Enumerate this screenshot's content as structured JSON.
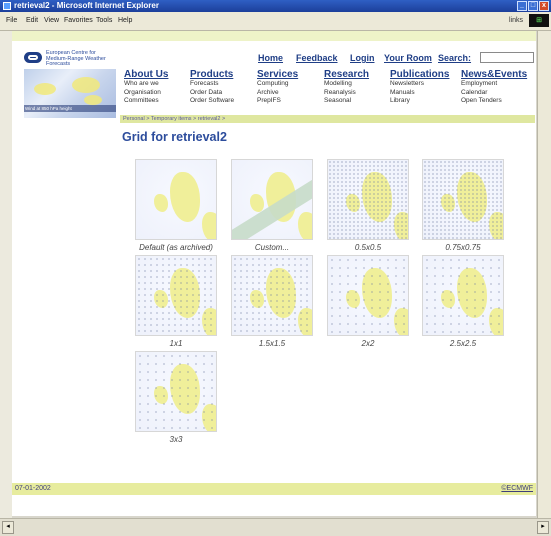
{
  "window": {
    "title": "retrieval2 - Microsoft Internet Explorer",
    "controls": [
      "_",
      "□",
      "x"
    ]
  },
  "menu": {
    "items": [
      "File",
      "Edit",
      "View",
      "Favorites",
      "Tools",
      "Help"
    ],
    "links_label": "links",
    "logo_glyph": "⊞"
  },
  "header": {
    "org_name": "European Centre for Medium-Range Weather Forecasts",
    "nav": [
      "Home",
      "Feedback",
      "Login",
      "Your Room",
      "Search:"
    ],
    "search_value": "",
    "weather_caption": "Wind at 850 hPa height"
  },
  "mainnav": [
    {
      "label": "About Us",
      "subs": [
        "Who are we",
        "Organisation",
        "Committees"
      ]
    },
    {
      "label": "Products",
      "subs": [
        "Forecasts",
        "Order Data",
        "Order Software"
      ]
    },
    {
      "label": "Services",
      "subs": [
        "Computing",
        "Archive",
        "PrepIFS"
      ]
    },
    {
      "label": "Research",
      "subs": [
        "Modelling",
        "Reanalysis",
        "Seasonal"
      ]
    },
    {
      "label": "Publications",
      "subs": [
        "Newsletters",
        "Manuals",
        "Library"
      ]
    },
    {
      "label": "News&Events",
      "subs": [
        "Employment",
        "Calendar",
        "Open Tenders"
      ]
    }
  ],
  "breadcrumb": "Personal > Temporary items > retrieval2 >",
  "page_title": "Grid for retrieval2",
  "grid_options": [
    {
      "label": "Default (as archived)",
      "style": "plain"
    },
    {
      "label": "Custom...",
      "style": "stripe"
    },
    {
      "label": "0.5x0.5",
      "style": "dense"
    },
    {
      "label": "0.75x0.75",
      "style": "dense"
    },
    {
      "label": "1x1",
      "style": "medium"
    },
    {
      "label": "1.5x1.5",
      "style": "medium"
    },
    {
      "label": "2x2",
      "style": "sparse"
    },
    {
      "label": "2.5x2.5",
      "style": "sparse"
    },
    {
      "label": "3x3",
      "style": "sparse"
    }
  ],
  "footer": {
    "date": "07-01-2002",
    "copyright": "©ECMWF"
  },
  "scroll": {
    "left_arrow": "◂",
    "right_arrow": "▸"
  }
}
